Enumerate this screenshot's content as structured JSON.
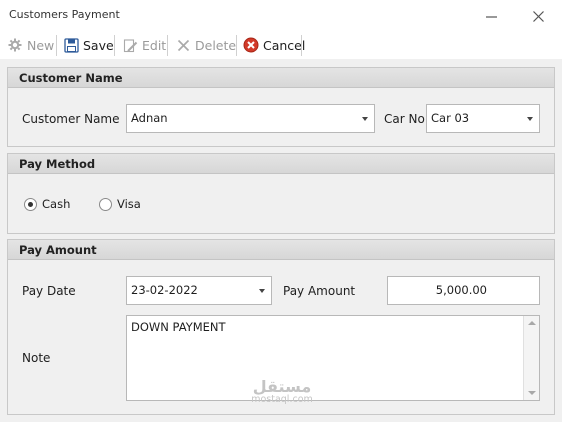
{
  "window": {
    "title": "Customers Payment"
  },
  "toolbar": {
    "new_label": "New",
    "save_label": "Save",
    "edit_label": "Edit",
    "delete_label": "Delete",
    "cancel_label": "Cancel"
  },
  "customer_group": {
    "header": "Customer Name",
    "customer_label": "Customer Name",
    "customer_value": "Adnan",
    "car_label": "Car No",
    "car_value": "Car 03"
  },
  "pay_method_group": {
    "header": "Pay Method",
    "options": [
      {
        "label": "Cash",
        "selected": true
      },
      {
        "label": "Visa",
        "selected": false
      }
    ]
  },
  "pay_amount_group": {
    "header": "Pay Amount",
    "date_label": "Pay Date",
    "date_value": "23-02-2022",
    "amount_label": "Pay Amount",
    "amount_value": "5,000.00",
    "note_label": "Note",
    "note_value": "DOWN PAYMENT"
  },
  "watermark": {
    "logo": "مستقل",
    "text": "mostaql.com"
  }
}
